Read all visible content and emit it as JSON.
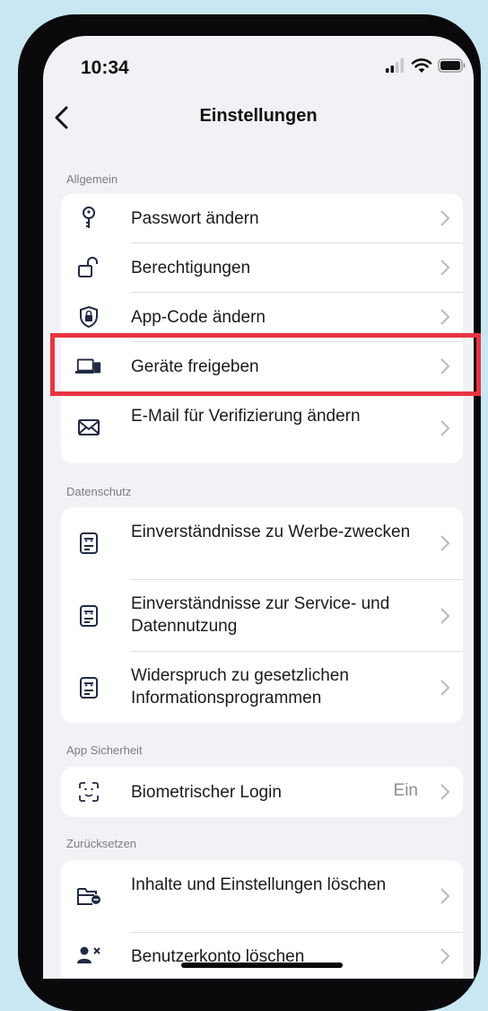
{
  "status_bar": {
    "time": "10:34"
  },
  "nav": {
    "title": "Einstellungen"
  },
  "sections": {
    "allgemein": {
      "label": "Allgemein",
      "items": [
        {
          "label": "Passwort ändern",
          "icon": "key-icon"
        },
        {
          "label": "Berechtigungen",
          "icon": "unlock-icon"
        },
        {
          "label": "App-Code ändern",
          "icon": "shield-lock-icon"
        },
        {
          "label": "Geräte freigeben",
          "icon": "devices-icon"
        },
        {
          "label": "E-Mail für Verifizierung ändern",
          "icon": "envelope-icon"
        }
      ]
    },
    "datenschutz": {
      "label": "Datenschutz",
      "items": [
        {
          "label": "Einverständnisse zu Werbe-zwecken",
          "icon": "consent-document-icon"
        },
        {
          "label": "Einverständnisse zur Service- und Datennutzung",
          "icon": "consent-document-icon"
        },
        {
          "label": "Widerspruch zu gesetzlichen Informationsprogrammen",
          "icon": "consent-document-icon"
        }
      ]
    },
    "sicherheit": {
      "label": "App Sicherheit",
      "items": [
        {
          "label": "Biometrischer Login",
          "value": "Ein",
          "icon": "face-id-icon"
        }
      ]
    },
    "zuruecksetzen": {
      "label": "Zurücksetzen",
      "items": [
        {
          "label": "Inhalte und Einstellungen löschen",
          "icon": "folder-remove-icon"
        },
        {
          "label": "Benutzerkonto löschen",
          "icon": "user-remove-icon"
        }
      ]
    }
  },
  "colors": {
    "background": "#c9e7f2",
    "highlight": "#e93442",
    "icon": "#1f2a44"
  }
}
